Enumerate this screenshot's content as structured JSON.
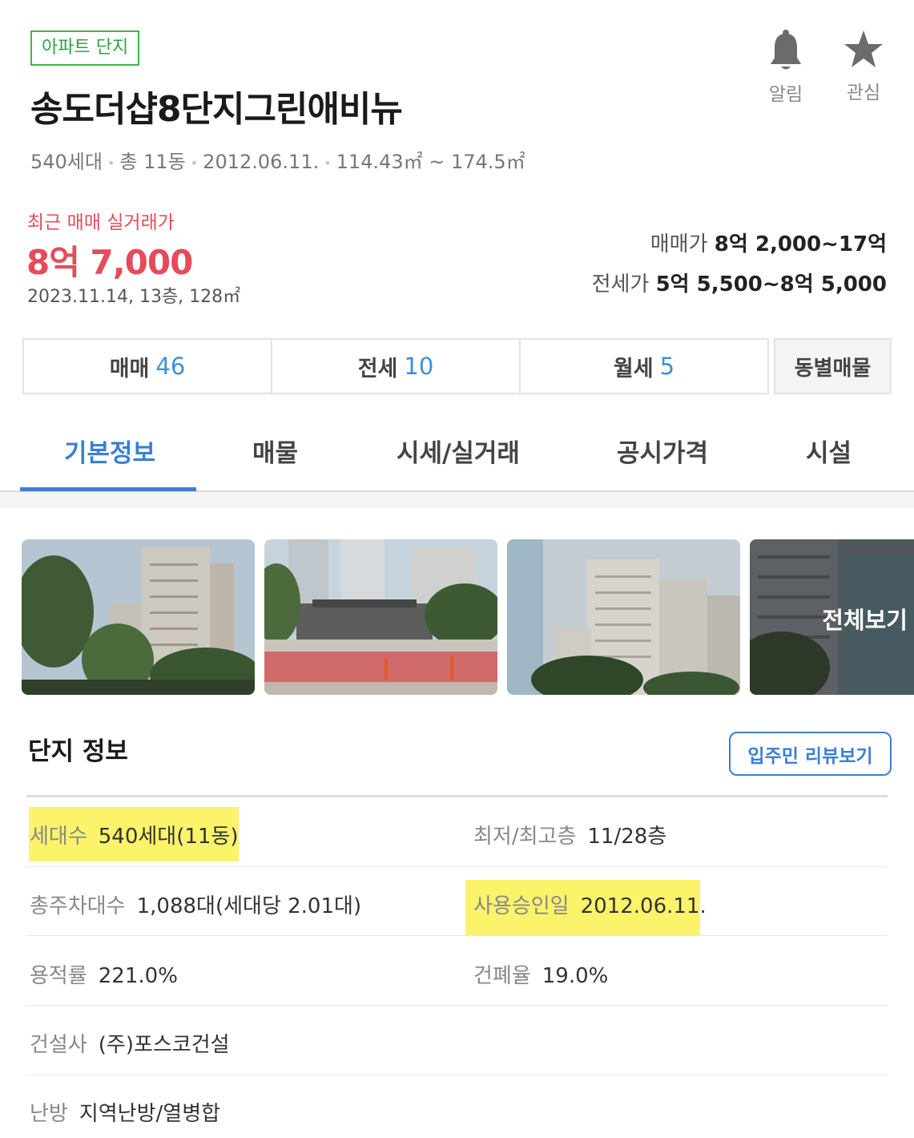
{
  "header": {
    "tag": "아파트 단지",
    "title": "송도더샵8단지그린애비뉴",
    "meta": [
      "540세대",
      "총 11동",
      "2012.06.11.",
      "114.43㎡ ~ 174.5㎡"
    ],
    "alarm_label": "알림",
    "favorite_label": "관심"
  },
  "recent_trade": {
    "label": "최근 매매 실거래가",
    "price": "8억 7,000",
    "detail": "2023.11.14, 13층, 128㎡"
  },
  "price_ranges": {
    "sale_label": "매매가",
    "sale_value": "8억 2,000~17억",
    "jeonse_label": "전세가",
    "jeonse_value": "5억 5,500~8억 5,000"
  },
  "deal_tabs": [
    {
      "label": "매매",
      "count": "46"
    },
    {
      "label": "전세",
      "count": "10"
    },
    {
      "label": "월세",
      "count": "5"
    }
  ],
  "dong_button": "동별매물",
  "nav_tabs": [
    "기본정보",
    "매물",
    "시세/실거래",
    "공시가격",
    "시설"
  ],
  "photos": {
    "view_all": "전체보기"
  },
  "complex_info": {
    "title": "단지 정보",
    "review_button": "입주민 리뷰보기",
    "rows": [
      {
        "key": "세대수",
        "value": "540세대(11동)"
      },
      {
        "key": "최저/최고층",
        "value": "11/28층"
      },
      {
        "key": "총주차대수",
        "value": "1,088대(세대당 2.01대)"
      },
      {
        "key": "사용승인일",
        "value": "2012.06.11."
      },
      {
        "key": "용적률",
        "value": "221.0%"
      },
      {
        "key": "건폐율",
        "value": "19.0%"
      },
      {
        "key": "건설사",
        "value": "(주)포스코건설"
      },
      {
        "key": "난방",
        "value": "지역난방/열병합"
      }
    ]
  },
  "colors": {
    "accent": "#3a7fd8",
    "price_red": "#e64b5a",
    "tag_green": "#2ea23d",
    "highlight": "#fbf36a"
  }
}
